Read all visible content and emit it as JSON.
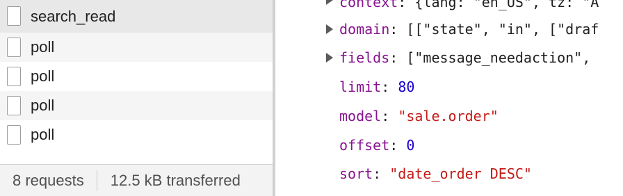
{
  "network": {
    "requests": [
      {
        "name": "search_read",
        "state": "selected"
      },
      {
        "name": "poll",
        "state": "alt"
      },
      {
        "name": "poll",
        "state": "plain"
      },
      {
        "name": "poll",
        "state": "alt"
      },
      {
        "name": "poll",
        "state": "plain"
      }
    ],
    "status": {
      "request_count": "8 requests",
      "transferred": "12.5 kB transferred"
    }
  },
  "payload": {
    "context": {
      "key": "context",
      "value": "{lang: \"en_US\", tz: \"A"
    },
    "domain": {
      "key": "domain",
      "value": "[[\"state\", \"in\", [\"draf"
    },
    "fields": {
      "key": "fields",
      "value": "[\"message_needaction\", "
    },
    "limit": {
      "key": "limit",
      "value": "80"
    },
    "model": {
      "key": "model",
      "value": "\"sale.order\""
    },
    "offset": {
      "key": "offset",
      "value": "0"
    },
    "sort": {
      "key": "sort",
      "value": "\"date_order DESC\""
    },
    "colon": ":"
  },
  "colors": {
    "key": "#881391",
    "string": "#c41a16",
    "number": "#1c00cf",
    "selected_row": "#e8e8e8"
  },
  "icons": {
    "request": "file-icon",
    "expand": "triangle-right-icon"
  }
}
